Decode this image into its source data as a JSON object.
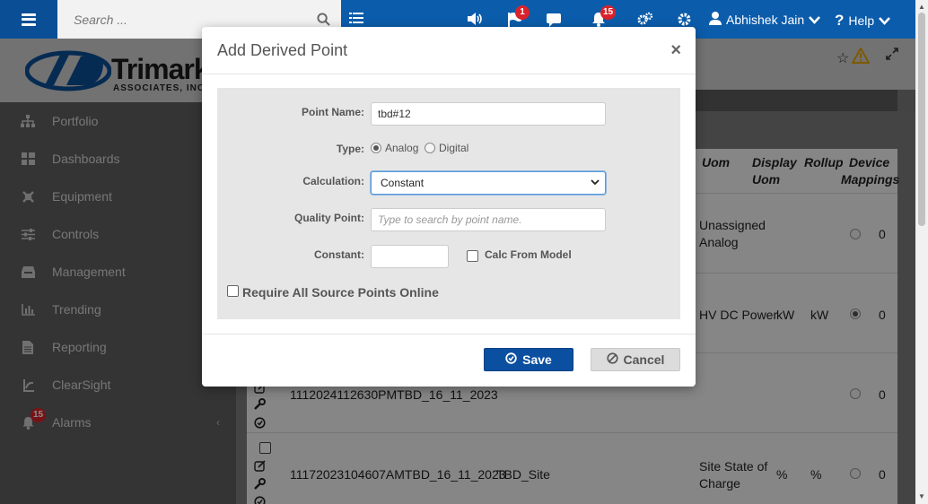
{
  "topbar": {
    "search_placeholder": "Search ...",
    "notification_flag_count": "1",
    "alarm_bell_count": "15",
    "user_name": "Abhishek Jain",
    "help_label": "Help"
  },
  "logo": {
    "name": "Trimark",
    "sub": "ASSOCIATES, INC"
  },
  "sidebar": {
    "items": [
      {
        "label": "Portfolio",
        "icon": "sitemap-icon"
      },
      {
        "label": "Dashboards",
        "icon": "dashboard-icon"
      },
      {
        "label": "Equipment",
        "icon": "equipment-icon"
      },
      {
        "label": "Controls",
        "icon": "sliders-icon"
      },
      {
        "label": "Management",
        "icon": "inbox-icon"
      },
      {
        "label": "Trending",
        "icon": "bar-chart-icon"
      },
      {
        "label": "Reporting",
        "icon": "document-icon"
      },
      {
        "label": "ClearSight",
        "icon": "clearsight-icon"
      },
      {
        "label": "Alarms",
        "icon": "bell-icon",
        "badge": "15"
      }
    ]
  },
  "table": {
    "headers": {
      "uom": "Uom",
      "display_uom_1": "Display",
      "display_uom_2": "Uom",
      "rollup": "Rollup",
      "device_1": "Device",
      "device_2": "Mappings"
    },
    "rows": [
      {
        "name": "",
        "site": "",
        "uom_1": "Unassigned",
        "uom_2": "Analog",
        "display_uom": "",
        "rollup": "",
        "selected": false,
        "mappings": "0"
      },
      {
        "name": "",
        "site": "",
        "uom_1": "HV DC Power",
        "uom_2": "",
        "display_uom": "kW",
        "rollup": "kW",
        "selected": true,
        "mappings": "0"
      },
      {
        "name": "1112024112630PMTBD_16_11_2023",
        "site": "",
        "uom_1": "",
        "uom_2": "",
        "display_uom": "",
        "rollup": "",
        "selected": false,
        "mappings": "0"
      },
      {
        "name": "11172023104607AMTBD_16_11_2023",
        "site": "TBD_Site",
        "uom_1": "Site State of",
        "uom_2": "Charge",
        "display_uom": "%",
        "rollup": "%",
        "selected": false,
        "mappings": "0"
      }
    ]
  },
  "modal": {
    "title": "Add Derived Point",
    "close": "×",
    "point_name_label": "Point Name:",
    "point_name_value": "tbd#12",
    "type_label": "Type:",
    "type_analog": "Analog",
    "type_digital": "Digital",
    "type_selected": "Analog",
    "calculation_label": "Calculation:",
    "calculation_value": "Constant",
    "quality_label": "Quality Point:",
    "quality_placeholder": "Type to search by point name.",
    "constant_label": "Constant:",
    "constant_value": "",
    "calc_from_model_label": "Calc From Model",
    "require_all_label": "Require All Source Points Online",
    "save_label": "Save",
    "cancel_label": "Cancel"
  },
  "colors": {
    "brand_blue": "#0b5cab",
    "save_blue": "#0b4fa0",
    "badge_red": "#d9232b",
    "alarm_yellow": "#f0b400"
  }
}
